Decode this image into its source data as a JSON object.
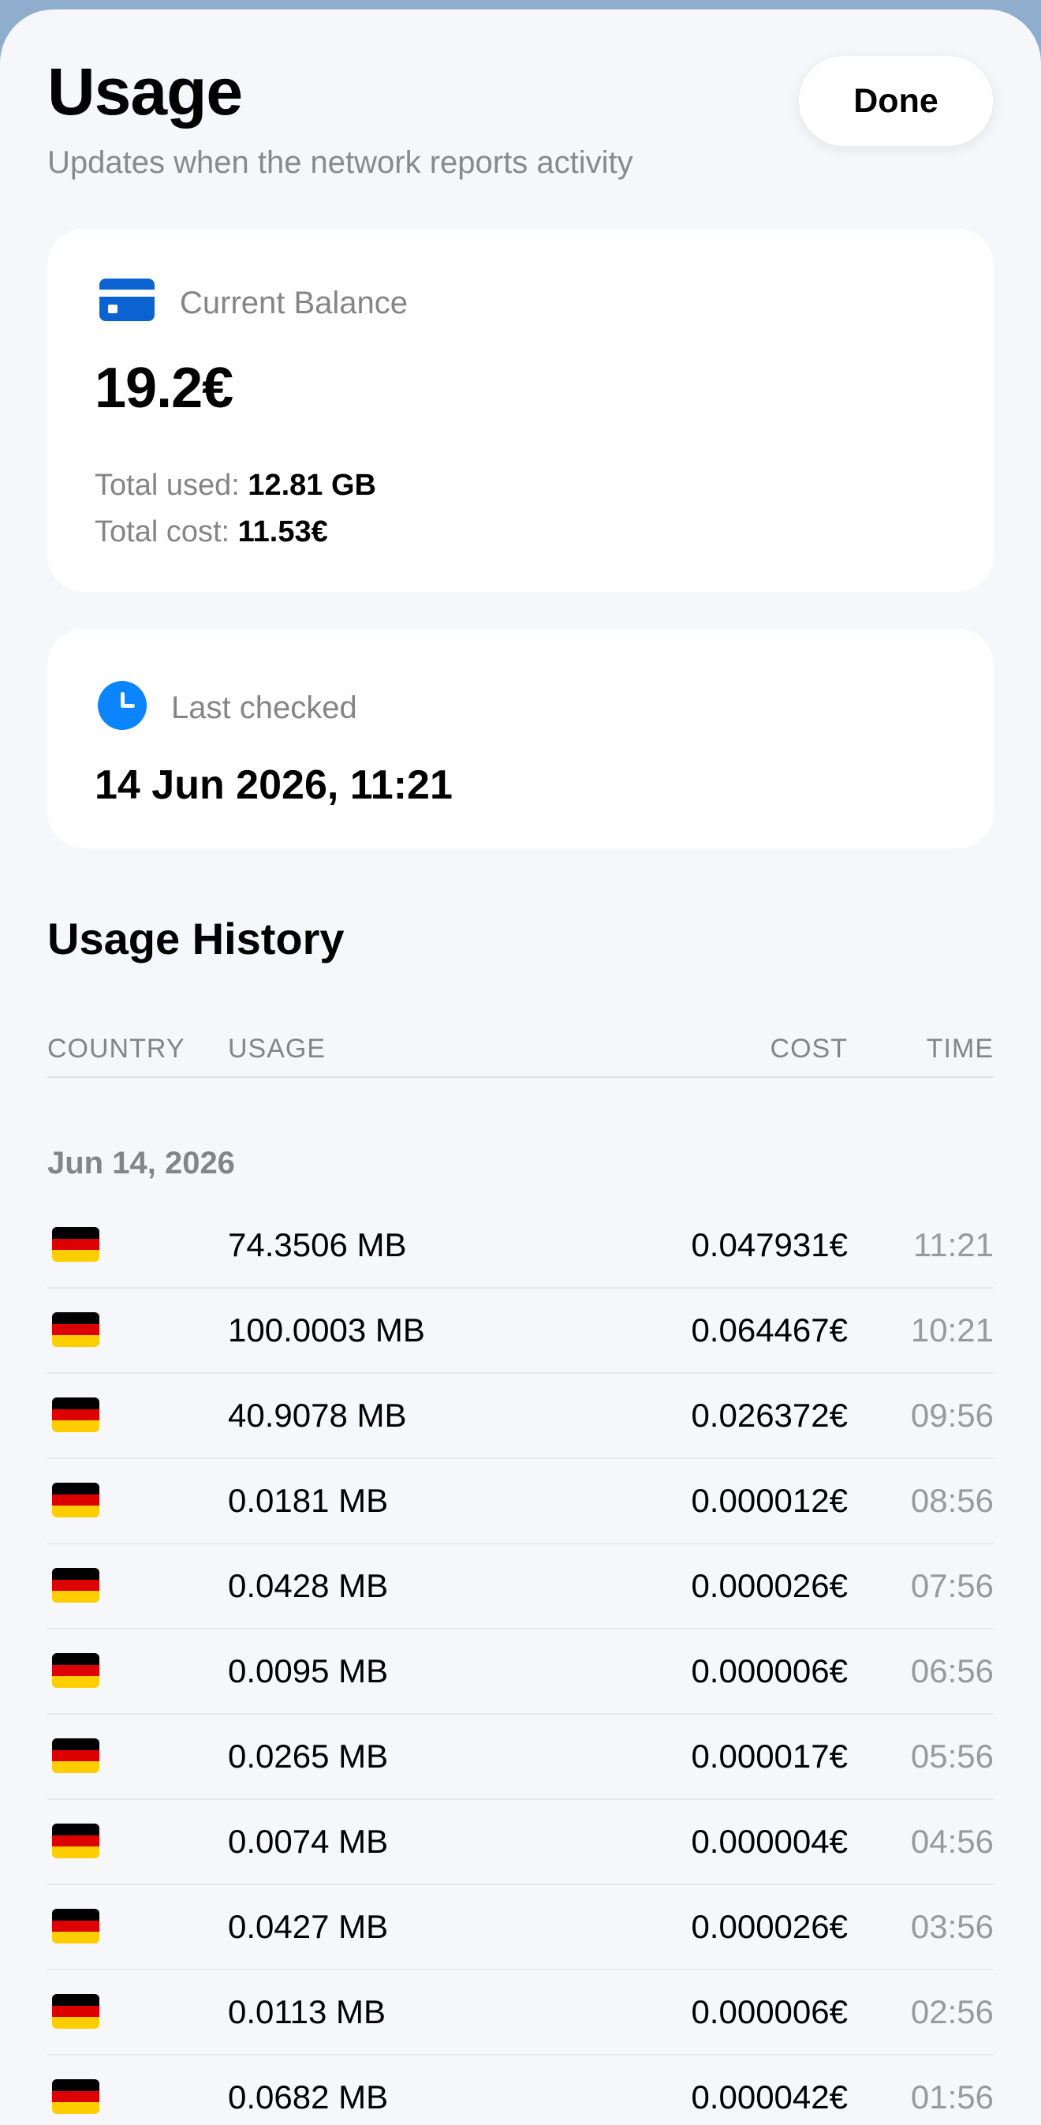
{
  "header": {
    "title": "Usage",
    "subtitle": "Updates when the network reports activity",
    "done_label": "Done"
  },
  "balance_card": {
    "label": "Current Balance",
    "value": "19.2€",
    "total_used_label": "Total used: ",
    "total_used_value": "12.81 GB",
    "total_cost_label": "Total cost: ",
    "total_cost_value": "11.53€",
    "icon": "credit-card-icon"
  },
  "checked_card": {
    "label": "Last checked",
    "value": "14 Jun 2026, 11:21",
    "icon": "clock-icon"
  },
  "history": {
    "title": "Usage History",
    "columns": [
      "COUNTRY",
      "USAGE",
      "COST",
      "TIME"
    ],
    "group_date": "Jun 14, 2026",
    "flag_colors": [
      "#000000",
      "#dd0000",
      "#ffce00"
    ],
    "rows": [
      {
        "flag": "germany-flag-icon",
        "usage": "74.3506 MB",
        "cost": "0.047931€",
        "time": "11:21"
      },
      {
        "flag": "germany-flag-icon",
        "usage": "100.0003 MB",
        "cost": "0.064467€",
        "time": "10:21"
      },
      {
        "flag": "germany-flag-icon",
        "usage": "40.9078 MB",
        "cost": "0.026372€",
        "time": "09:56"
      },
      {
        "flag": "germany-flag-icon",
        "usage": "0.0181 MB",
        "cost": "0.000012€",
        "time": "08:56"
      },
      {
        "flag": "germany-flag-icon",
        "usage": "0.0428 MB",
        "cost": "0.000026€",
        "time": "07:56"
      },
      {
        "flag": "germany-flag-icon",
        "usage": "0.0095 MB",
        "cost": "0.000006€",
        "time": "06:56"
      },
      {
        "flag": "germany-flag-icon",
        "usage": "0.0265 MB",
        "cost": "0.000017€",
        "time": "05:56"
      },
      {
        "flag": "germany-flag-icon",
        "usage": "0.0074 MB",
        "cost": "0.000004€",
        "time": "04:56"
      },
      {
        "flag": "germany-flag-icon",
        "usage": "0.0427 MB",
        "cost": "0.000026€",
        "time": "03:56"
      },
      {
        "flag": "germany-flag-icon",
        "usage": "0.0113 MB",
        "cost": "0.000006€",
        "time": "02:56"
      },
      {
        "flag": "germany-flag-icon",
        "usage": "0.0682 MB",
        "cost": "0.000042€",
        "time": "01:56"
      }
    ]
  },
  "colors": {
    "accent_blue": "#0a84ff",
    "card_icon_blue": "#0a63d1",
    "secondary_text": "#858588",
    "sheet_background": "#f6f7fb",
    "backdrop": "#8fadcc"
  }
}
